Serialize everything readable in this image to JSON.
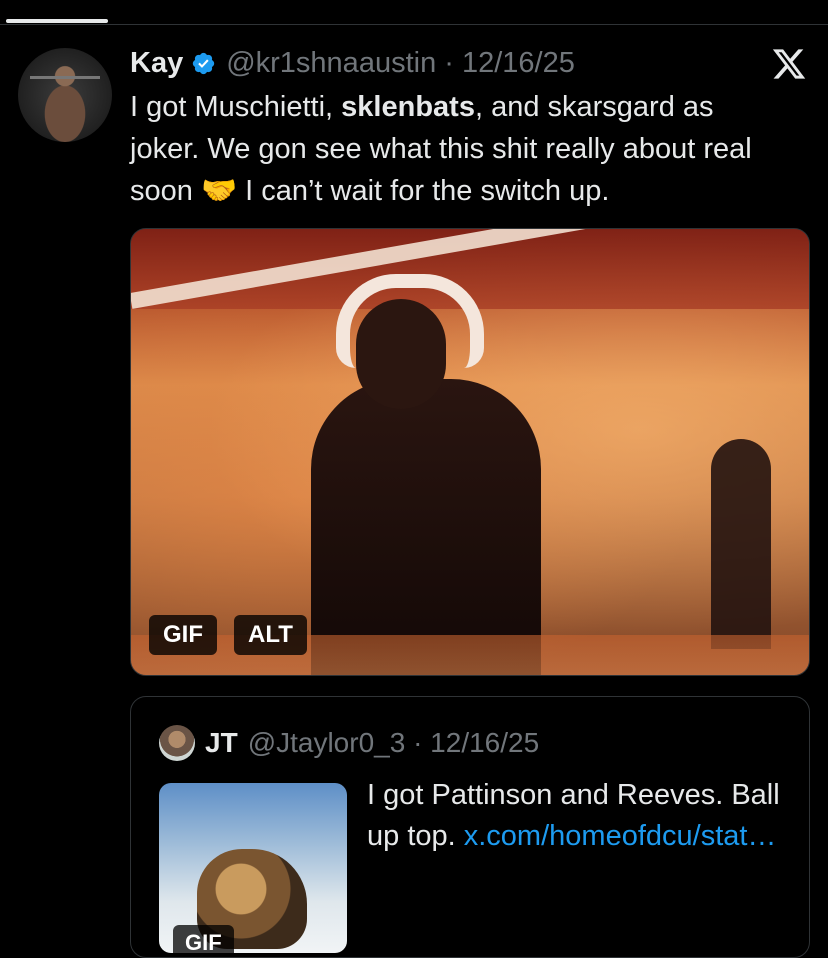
{
  "tweet": {
    "name": "Kay",
    "handle_time": "@kr1shnaaustin · 12/16/25",
    "text_part1": "I got Muschietti, ",
    "text_bold": "sklenbats",
    "text_part2": ", and skarsgard as joker. We gon see what this shit really about real soon ",
    "emoji": "🤝",
    "text_part3": " I can’t wait for the switch up.",
    "media": {
      "badge_gif": "GIF",
      "badge_alt": "ALT"
    }
  },
  "quote": {
    "name": "JT",
    "handle_time": "@Jtaylor0_3 · 12/16/25",
    "text": "I got Pattinson and Reeves. Ball up top. ",
    "link": "x.com/homeofdcu/stat…",
    "thumb_badge": "GIF"
  },
  "icons": {
    "verified": "verified-badge-icon",
    "x_logo": "x-logo-icon"
  },
  "colors": {
    "background": "#000000",
    "text": "#e7e9ea",
    "muted": "#71767b",
    "accent": "#1d9bf0"
  }
}
